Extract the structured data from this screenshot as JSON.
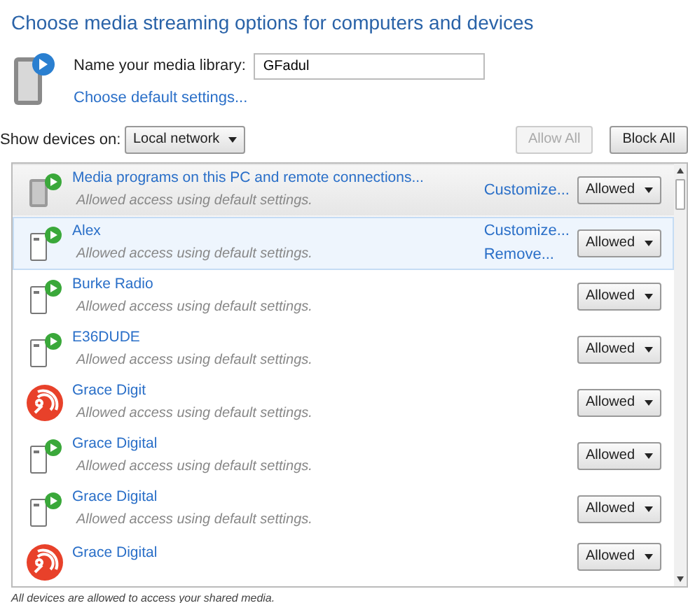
{
  "title": "Choose media streaming options for computers and devices",
  "library": {
    "label": "Name your media library:",
    "value": "GFadul",
    "link": "Choose default settings..."
  },
  "toolbar": {
    "label": "Show devices on:",
    "network": "Local network",
    "buttons": [
      {
        "label": "Allow All",
        "disabled": true
      },
      {
        "label": "Block All",
        "disabled": false
      }
    ]
  },
  "devices": [
    {
      "kind": "local",
      "name": "Media programs on this PC and remote connections...",
      "description": "Allowed access using default settings.",
      "links": [
        "Customize..."
      ],
      "access": "Allowed",
      "selected": false
    },
    {
      "kind": "device",
      "name": "Alex",
      "description": "Allowed access using default settings.",
      "links": [
        "Customize...",
        "Remove..."
      ],
      "access": "Allowed",
      "selected": true
    },
    {
      "kind": "device",
      "name": "Burke Radio",
      "description": "Allowed access using default settings.",
      "access": "Allowed",
      "selected": false
    },
    {
      "kind": "device",
      "name": "E36DUDE",
      "description": "Allowed access using default settings.",
      "access": "Allowed",
      "selected": false
    },
    {
      "kind": "radio",
      "name": "Grace Digit",
      "description": "Allowed access using default settings.",
      "access": "Allowed",
      "selected": false
    },
    {
      "kind": "device",
      "name": "Grace Digital",
      "description": "Allowed access using default settings.",
      "access": "Allowed",
      "selected": false
    },
    {
      "kind": "device",
      "name": "Grace Digital",
      "description": "Allowed access using default settings.",
      "access": "Allowed",
      "selected": false
    },
    {
      "kind": "radio",
      "name": "Grace Digital",
      "access": "Allowed",
      "selected": false
    }
  ],
  "footer": "All devices are allowed to access your shared media."
}
